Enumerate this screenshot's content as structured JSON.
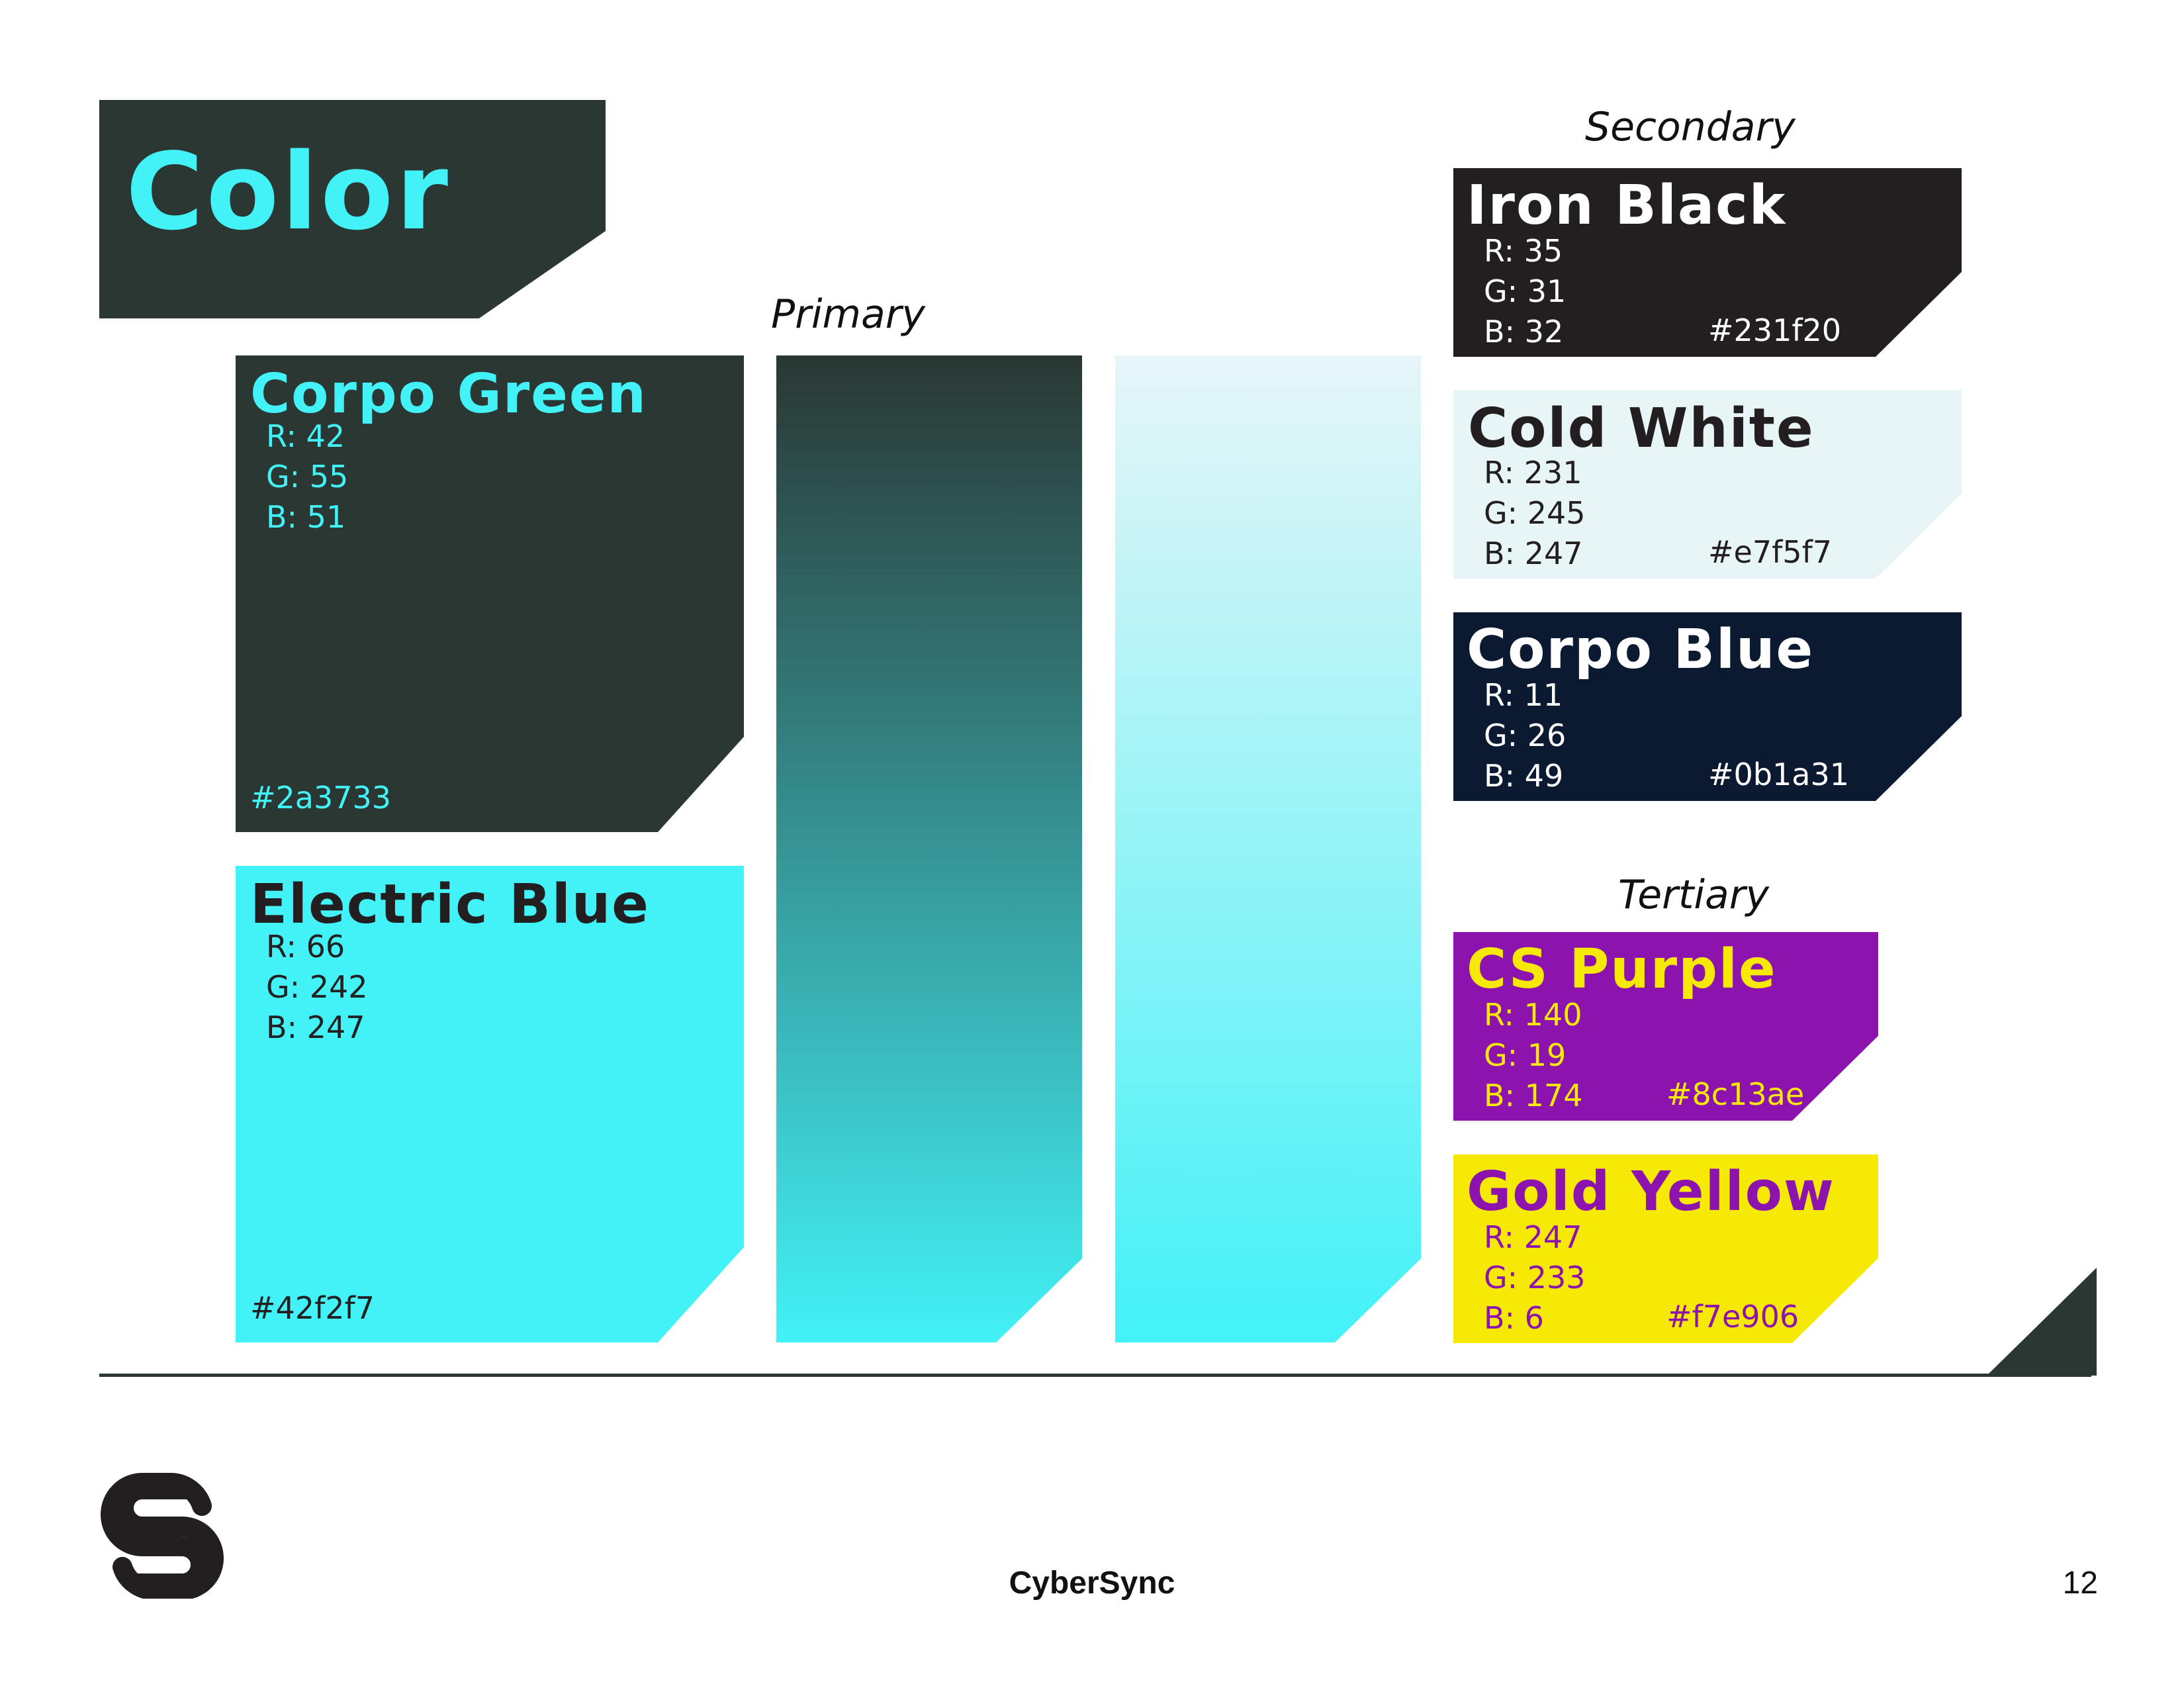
{
  "page": {
    "title": "Color",
    "labels": {
      "primary": "Primary",
      "secondary": "Secondary",
      "tertiary": "Tertiary"
    },
    "footer": {
      "brand": "CyberSync",
      "page_number": "12"
    }
  },
  "colors": {
    "corpo_green": {
      "name": "Corpo Green",
      "r": "R: 42",
      "g": "G: 55",
      "b": "B: 51",
      "hex": "#2a3733",
      "swatch": "#2a3733",
      "text_color": "#42f2f7"
    },
    "electric_blue": {
      "name": "Electric Blue",
      "r": "R: 66",
      "g": "G: 242",
      "b": "B: 247",
      "hex": "#42f2f7",
      "swatch": "#42f2f7",
      "text_color": "#231f20"
    },
    "iron_black": {
      "name": "Iron Black",
      "r": "R: 35",
      "g": "G: 31",
      "b": "B: 32",
      "hex": "#231f20",
      "swatch": "#231f20",
      "text_color": "#ffffff"
    },
    "cold_white": {
      "name": "Cold White",
      "r": "R: 231",
      "g": "G: 245",
      "b": "B: 247",
      "hex": "#e7f5f7",
      "swatch": "#e7f5f7",
      "text_color": "#231f20"
    },
    "corpo_blue": {
      "name": "Corpo Blue",
      "r": "R: 11",
      "g": "G: 26",
      "b": "B: 49",
      "hex": "#0b1a31",
      "swatch": "#0b1a31",
      "text_color": "#ffffff"
    },
    "cs_purple": {
      "name": "CS Purple",
      "r": "R: 140",
      "g": "G: 19",
      "b": "B: 174",
      "hex": "#8c13ae",
      "swatch": "#8c13ae",
      "text_color": "#f7e906"
    },
    "gold_yellow": {
      "name": "Gold Yellow",
      "r": "R: 247",
      "g": "G: 233",
      "b": "B: 6",
      "hex": "#f7e906",
      "swatch": "#f7e906",
      "text_color": "#8c13ae"
    }
  },
  "gradients": {
    "green_to_blue": {
      "from": "#2a3733",
      "to": "#42f2f7"
    },
    "white_to_blue": {
      "from": "#e7f5f7",
      "to": "#42f2f7"
    }
  }
}
